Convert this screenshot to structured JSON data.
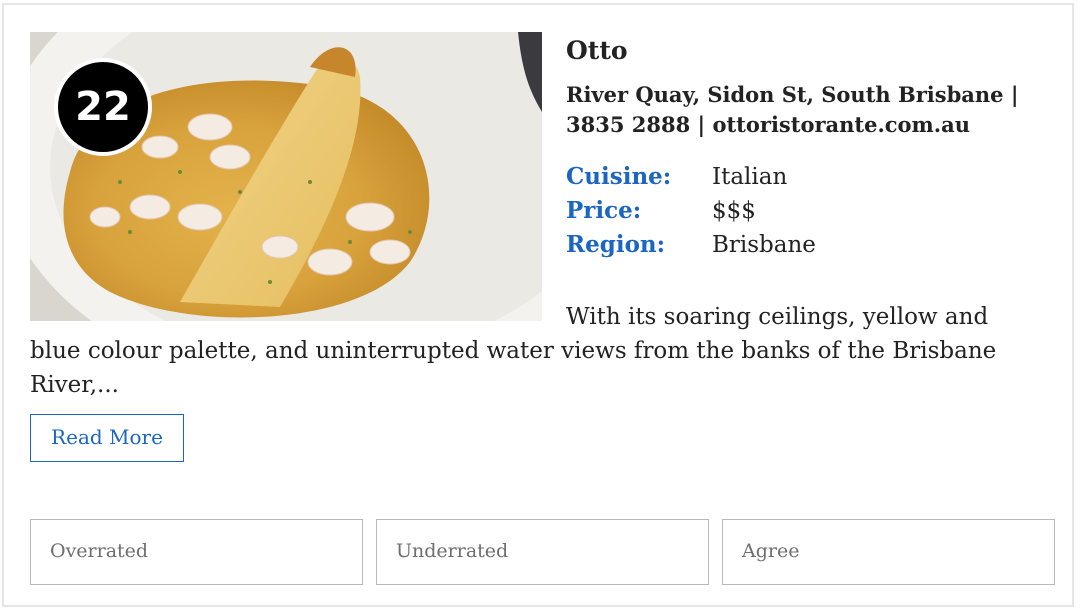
{
  "listing": {
    "rank": "22",
    "name": "Otto",
    "address_line1": "River Quay, Sidon St, South Brisbane |",
    "address_line2": "3835 2888 | ottoristorante.com.au",
    "details": [
      {
        "label": "Cuisine:",
        "value": "Italian"
      },
      {
        "label": "Price:",
        "value": "$$$"
      },
      {
        "label": "Region:",
        "value": "Brisbane"
      }
    ],
    "description": "With its soaring ceilings, yellow and blue colour palette, and uninterrupted water views from the banks of the Brisbane River,...",
    "read_more_label": "Read More"
  },
  "votes": {
    "overrated": "Overrated",
    "underrated": "Underrated",
    "agree": "Agree"
  },
  "colors": {
    "accent": "#1a66c2",
    "text": "#222222",
    "border": "#b9b9b9",
    "badge": "#000000"
  }
}
